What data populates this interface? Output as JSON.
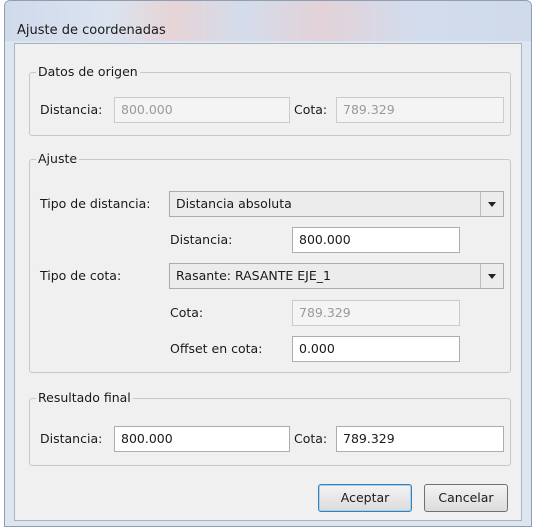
{
  "dialog": {
    "title": "Ajuste de coordenadas"
  },
  "origen": {
    "legend": "Datos de origen",
    "distancia_label": "Distancia:",
    "distancia_value": "800.000",
    "cota_label": "Cota:",
    "cota_value": "789.329"
  },
  "ajuste": {
    "legend": "Ajuste",
    "tipo_distancia_label": "Tipo de distancia:",
    "tipo_distancia_value": "Distancia absoluta",
    "distancia_label": "Distancia:",
    "distancia_value": "800.000",
    "tipo_cota_label": "Tipo de cota:",
    "tipo_cota_value": "Rasante: RASANTE EJE_1",
    "cota_label": "Cota:",
    "cota_value": "789.329",
    "offset_label": "Offset en cota:",
    "offset_value": "0.000"
  },
  "resultado": {
    "legend": "Resultado final",
    "distancia_label": "Distancia:",
    "distancia_value": "800.000",
    "cota_label": "Cota:",
    "cota_value": "789.329"
  },
  "buttons": {
    "aceptar": "Aceptar",
    "cancelar": "Cancelar"
  }
}
